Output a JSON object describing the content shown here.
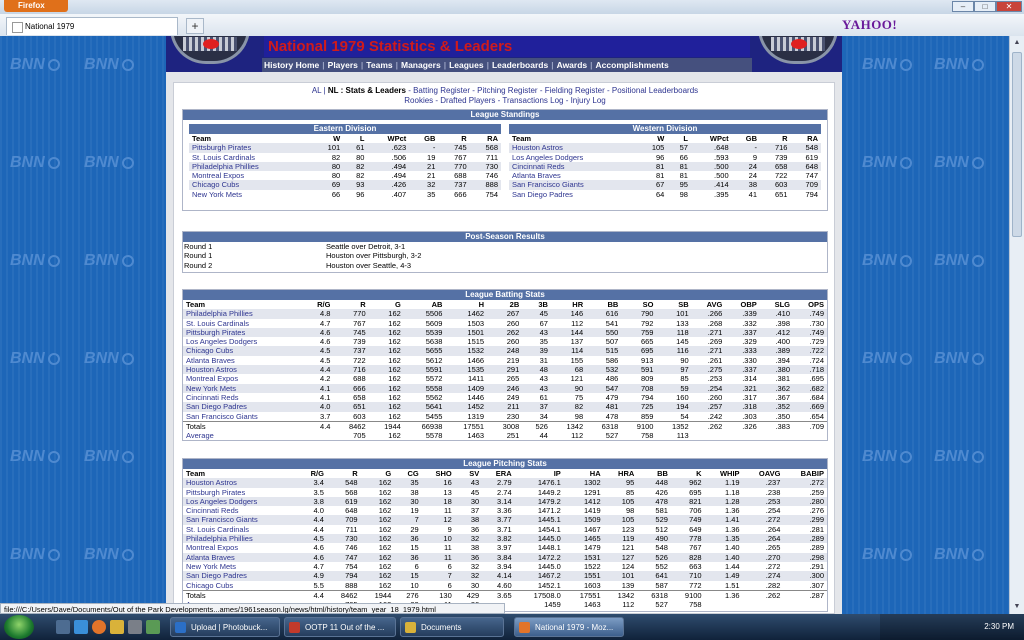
{
  "browser": {
    "app_button": "Firefox",
    "tab_title": "National 1979",
    "new_tab": "+",
    "search_brand": "YAHOO!",
    "status_url": "file:///C:/Users/Dave/Documents/Out of the Park Developments...ames/1961season.lg/news/html/history/team_year_18_1979.html"
  },
  "page": {
    "title": "National 1979 Statistics & Leaders",
    "nav": [
      "History Home",
      "Players",
      "Teams",
      "Managers",
      "Leagues",
      "Leaderboards",
      "Awards",
      "Accomplishments"
    ],
    "league_al": "AL",
    "league_nl": "NL : Stats & Leaders",
    "sublinks_row1": [
      "Batting Register",
      "Pitching Register",
      "Fielding Register",
      "Positional Leaderboards"
    ],
    "sublinks_row2": [
      "Rookies",
      "Drafted Players",
      "Transactions Log",
      "Injury Log"
    ],
    "watermark": "BNN"
  },
  "standings": {
    "title": "League Standings",
    "columns": [
      "Team",
      "W",
      "L",
      "WPct",
      "GB",
      "R",
      "RA"
    ],
    "east": {
      "title": "Eastern Division",
      "rows": [
        [
          "Pittsburgh Pirates",
          "101",
          "61",
          ".623",
          "-",
          "745",
          "568"
        ],
        [
          "St. Louis Cardinals",
          "82",
          "80",
          ".506",
          "19",
          "767",
          "711"
        ],
        [
          "Philadelphia Phillies",
          "80",
          "82",
          ".494",
          "21",
          "770",
          "730"
        ],
        [
          "Montreal Expos",
          "80",
          "82",
          ".494",
          "21",
          "688",
          "746"
        ],
        [
          "Chicago Cubs",
          "69",
          "93",
          ".426",
          "32",
          "737",
          "888"
        ],
        [
          "New York Mets",
          "66",
          "96",
          ".407",
          "35",
          "666",
          "754"
        ]
      ]
    },
    "west": {
      "title": "Western Division",
      "rows": [
        [
          "Houston Astros",
          "105",
          "57",
          ".648",
          "-",
          "716",
          "548"
        ],
        [
          "Los Angeles Dodgers",
          "96",
          "66",
          ".593",
          "9",
          "739",
          "619"
        ],
        [
          "Cincinnati Reds",
          "81",
          "81",
          ".500",
          "24",
          "658",
          "648"
        ],
        [
          "Atlanta Braves",
          "81",
          "81",
          ".500",
          "24",
          "722",
          "747"
        ],
        [
          "San Francisco Giants",
          "67",
          "95",
          ".414",
          "38",
          "603",
          "709"
        ],
        [
          "San Diego Padres",
          "64",
          "98",
          ".395",
          "41",
          "651",
          "794"
        ]
      ]
    }
  },
  "postseason": {
    "title": "Post-Season Results",
    "rows": [
      [
        "Round 1",
        "Seattle over Detroit, 3-1"
      ],
      [
        "Round 1",
        "Houston over Pittsburgh, 3-2"
      ],
      [
        "Round 2",
        "Houston over Seattle, 4-3"
      ]
    ]
  },
  "batting": {
    "title": "League Batting Stats",
    "columns": [
      "Team",
      "R/G",
      "R",
      "G",
      "AB",
      "H",
      "2B",
      "3B",
      "HR",
      "BB",
      "SO",
      "SB",
      "AVG",
      "OBP",
      "SLG",
      "OPS"
    ],
    "rows": [
      [
        "Philadelphia Phillies",
        "4.8",
        "770",
        "162",
        "5506",
        "1462",
        "267",
        "45",
        "146",
        "616",
        "790",
        "101",
        ".266",
        ".339",
        ".410",
        ".749"
      ],
      [
        "St. Louis Cardinals",
        "4.7",
        "767",
        "162",
        "5609",
        "1503",
        "260",
        "67",
        "112",
        "541",
        "792",
        "133",
        ".268",
        ".332",
        ".398",
        ".730"
      ],
      [
        "Pittsburgh Pirates",
        "4.6",
        "745",
        "162",
        "5539",
        "1501",
        "262",
        "43",
        "144",
        "550",
        "759",
        "118",
        ".271",
        ".337",
        ".412",
        ".749"
      ],
      [
        "Los Angeles Dodgers",
        "4.6",
        "739",
        "162",
        "5638",
        "1515",
        "260",
        "35",
        "137",
        "507",
        "665",
        "145",
        ".269",
        ".329",
        ".400",
        ".729"
      ],
      [
        "Chicago Cubs",
        "4.5",
        "737",
        "162",
        "5655",
        "1532",
        "248",
        "39",
        "114",
        "515",
        "695",
        "116",
        ".271",
        ".333",
        ".389",
        ".722"
      ],
      [
        "Atlanta Braves",
        "4.5",
        "722",
        "162",
        "5612",
        "1466",
        "219",
        "31",
        "155",
        "586",
        "913",
        "90",
        ".261",
        ".330",
        ".394",
        ".724"
      ],
      [
        "Houston Astros",
        "4.4",
        "716",
        "162",
        "5591",
        "1535",
        "291",
        "48",
        "68",
        "532",
        "591",
        "97",
        ".275",
        ".337",
        ".380",
        ".718"
      ],
      [
        "Montreal Expos",
        "4.2",
        "688",
        "162",
        "5572",
        "1411",
        "265",
        "43",
        "121",
        "486",
        "809",
        "85",
        ".253",
        ".314",
        ".381",
        ".695"
      ],
      [
        "New York Mets",
        "4.1",
        "666",
        "162",
        "5558",
        "1409",
        "246",
        "43",
        "90",
        "547",
        "708",
        "59",
        ".254",
        ".321",
        ".362",
        ".682"
      ],
      [
        "Cincinnati Reds",
        "4.1",
        "658",
        "162",
        "5562",
        "1446",
        "249",
        "61",
        "75",
        "479",
        "794",
        "160",
        ".260",
        ".317",
        ".367",
        ".684"
      ],
      [
        "San Diego Padres",
        "4.0",
        "651",
        "162",
        "5641",
        "1452",
        "211",
        "37",
        "82",
        "481",
        "725",
        "194",
        ".257",
        ".318",
        ".352",
        ".669"
      ],
      [
        "San Francisco Giants",
        "3.7",
        "603",
        "162",
        "5455",
        "1319",
        "230",
        "34",
        "98",
        "478",
        "859",
        "54",
        ".242",
        ".303",
        ".350",
        ".654"
      ]
    ],
    "totals": [
      "Totals",
      "4.4",
      "8462",
      "1944",
      "66938",
      "17551",
      "3008",
      "526",
      "1342",
      "6318",
      "9100",
      "1352",
      ".262",
      ".326",
      ".383",
      ".709"
    ],
    "average": [
      "Average",
      "",
      "705",
      "162",
      "5578",
      "1463",
      "251",
      "44",
      "112",
      "527",
      "758",
      "113",
      "",
      "",
      "",
      ""
    ]
  },
  "pitching": {
    "title": "League Pitching Stats",
    "columns": [
      "Team",
      "R/G",
      "R",
      "G",
      "CG",
      "SHO",
      "SV",
      "ERA",
      "IP",
      "HA",
      "HRA",
      "BB",
      "K",
      "WHIP",
      "OAVG",
      "BABIP"
    ],
    "rows": [
      [
        "Houston Astros",
        "3.4",
        "548",
        "162",
        "35",
        "16",
        "43",
        "2.79",
        "1476.1",
        "1302",
        "95",
        "448",
        "962",
        "1.19",
        ".237",
        ".272"
      ],
      [
        "Pittsburgh Pirates",
        "3.5",
        "568",
        "162",
        "38",
        "13",
        "45",
        "2.74",
        "1449.2",
        "1291",
        "85",
        "426",
        "695",
        "1.18",
        ".238",
        ".259"
      ],
      [
        "Los Angeles Dodgers",
        "3.8",
        "619",
        "162",
        "30",
        "18",
        "30",
        "3.14",
        "1479.2",
        "1412",
        "105",
        "478",
        "821",
        "1.28",
        ".253",
        ".280"
      ],
      [
        "Cincinnati Reds",
        "4.0",
        "648",
        "162",
        "19",
        "11",
        "37",
        "3.36",
        "1471.2",
        "1419",
        "98",
        "581",
        "706",
        "1.36",
        ".254",
        ".276"
      ],
      [
        "San Francisco Giants",
        "4.4",
        "709",
        "162",
        "7",
        "12",
        "38",
        "3.77",
        "1445.1",
        "1509",
        "105",
        "529",
        "749",
        "1.41",
        ".272",
        ".299"
      ],
      [
        "St. Louis Cardinals",
        "4.4",
        "711",
        "162",
        "29",
        "9",
        "36",
        "3.71",
        "1454.1",
        "1467",
        "123",
        "512",
        "649",
        "1.36",
        ".264",
        ".281"
      ],
      [
        "Philadelphia Phillies",
        "4.5",
        "730",
        "162",
        "36",
        "10",
        "32",
        "3.82",
        "1445.0",
        "1465",
        "119",
        "490",
        "778",
        "1.35",
        ".264",
        ".289"
      ],
      [
        "Montreal Expos",
        "4.6",
        "746",
        "162",
        "15",
        "11",
        "38",
        "3.97",
        "1448.1",
        "1479",
        "121",
        "548",
        "767",
        "1.40",
        ".265",
        ".289"
      ],
      [
        "Atlanta Braves",
        "4.6",
        "747",
        "162",
        "36",
        "11",
        "36",
        "3.84",
        "1472.2",
        "1531",
        "127",
        "526",
        "828",
        "1.40",
        ".270",
        ".298"
      ],
      [
        "New York Mets",
        "4.7",
        "754",
        "162",
        "6",
        "6",
        "32",
        "3.94",
        "1445.0",
        "1522",
        "124",
        "552",
        "663",
        "1.44",
        ".272",
        ".291"
      ],
      [
        "San Diego Padres",
        "4.9",
        "794",
        "162",
        "15",
        "7",
        "32",
        "4.14",
        "1467.2",
        "1551",
        "101",
        "641",
        "710",
        "1.49",
        ".274",
        ".300"
      ],
      [
        "Chicago Cubs",
        "5.5",
        "888",
        "162",
        "10",
        "6",
        "30",
        "4.60",
        "1452.1",
        "1603",
        "139",
        "587",
        "772",
        "1.51",
        ".282",
        ".307"
      ]
    ],
    "totals": [
      "Totals",
      "4.4",
      "8462",
      "1944",
      "276",
      "130",
      "429",
      "3.65",
      "17508.0",
      "17551",
      "1342",
      "6318",
      "9100",
      "1.36",
      ".262",
      ".287"
    ],
    "average": [
      "Average",
      "",
      "705",
      "162",
      "23",
      "11",
      "36",
      "",
      "1459",
      "1463",
      "112",
      "527",
      "758",
      "",
      "",
      ""
    ]
  },
  "taskbar": {
    "items": [
      "Upload | Photobuck...",
      "OOTP 11 Out of the ...",
      "Documents",
      "National 1979 - Moz..."
    ],
    "clock": "2:30 PM"
  }
}
